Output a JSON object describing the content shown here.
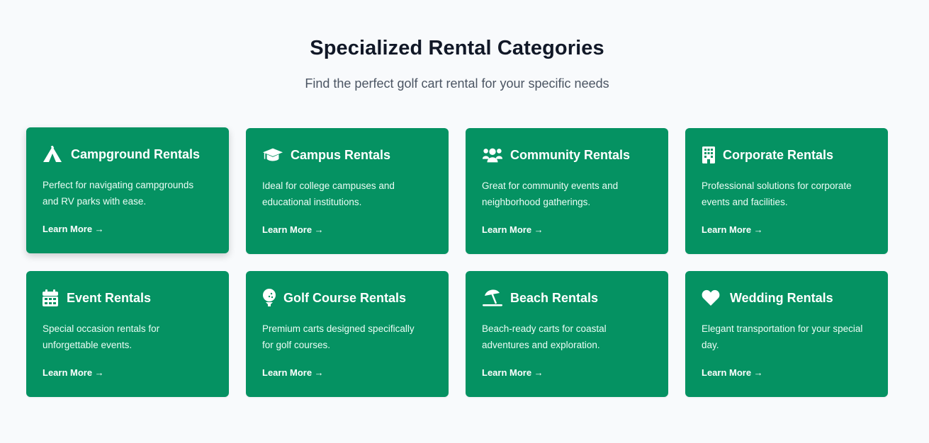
{
  "section": {
    "title": "Specialized Rental Categories",
    "subtitle": "Find the perfect golf cart rental for your specific needs"
  },
  "colors": {
    "page_bg": "#f8fafc",
    "card_bg": "#059262",
    "title_text": "#111827",
    "subtitle_text": "#4b5563"
  },
  "cards": [
    {
      "icon": "tent-icon",
      "title": "Campground Rentals",
      "description": "Perfect for navigating campgrounds and RV parks with ease.",
      "link": "Learn More →"
    },
    {
      "icon": "graduation-cap-icon",
      "title": "Campus Rentals",
      "description": "Ideal for college campuses and educational institutions.",
      "link": "Learn More →"
    },
    {
      "icon": "users-icon",
      "title": "Community Rentals",
      "description": "Great for community events and neighborhood gatherings.",
      "link": "Learn More →"
    },
    {
      "icon": "building-icon",
      "title": "Corporate Rentals",
      "description": "Professional solutions for corporate events and facilities.",
      "link": "Learn More →"
    },
    {
      "icon": "calendar-icon",
      "title": "Event Rentals",
      "description": "Special occasion rentals for unforgettable events.",
      "link": "Learn More →"
    },
    {
      "icon": "golf-ball-icon",
      "title": "Golf Course Rentals",
      "description": "Premium carts designed specifically for golf courses.",
      "link": "Learn More →"
    },
    {
      "icon": "umbrella-beach-icon",
      "title": "Beach Rentals",
      "description": "Beach-ready carts for coastal adventures and exploration.",
      "link": "Learn More →"
    },
    {
      "icon": "heart-icon",
      "title": "Wedding Rentals",
      "description": "Elegant transportation for your special day.",
      "link": "Learn More →"
    }
  ]
}
